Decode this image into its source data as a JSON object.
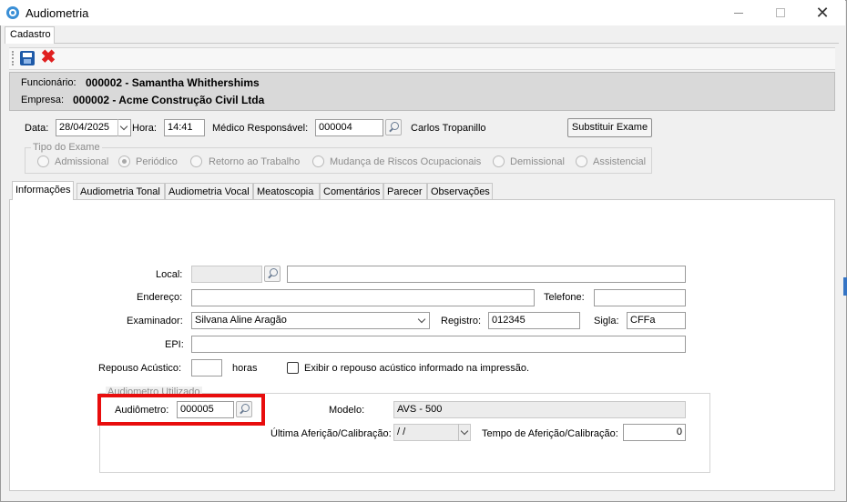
{
  "window": {
    "title": "Audiometria"
  },
  "page_tab": "Cadastro",
  "toolbar": {
    "save_icon": "save-icon",
    "delete_icon": "delete-icon"
  },
  "header": {
    "employee_label": "Funcionário:",
    "employee_value": "000002 - Samantha Whithershims",
    "company_label": "Empresa:",
    "company_value": "000002 - Acme Construção Civil Ltda"
  },
  "form": {
    "date_label": "Data:",
    "date_value": "28/04/2025",
    "time_label": "Hora:",
    "time_value": "14:41",
    "doctor_label": "Médico Responsável:",
    "doctor_code": "000004",
    "doctor_name": "Carlos Tropanillo",
    "replace_button": "Substituir Exame"
  },
  "exam_type": {
    "title": "Tipo do Exame",
    "options": [
      "Admissional",
      "Periódico",
      "Retorno ao Trabalho",
      "Mudança de Riscos Ocupacionais",
      "Demissional",
      "Assistencial"
    ],
    "selected": "Periódico"
  },
  "tabs": [
    "Informações",
    "Audiometria Tonal",
    "Audiometria Vocal",
    "Meatoscopia",
    "Comentários",
    "Parecer",
    "Observações"
  ],
  "active_tab": "Informações",
  "info": {
    "local_label": "Local:",
    "local_code": "",
    "local_value": "",
    "address_label": "Endereço:",
    "address_value": "",
    "phone_label": "Telefone:",
    "phone_value": "",
    "examiner_label": "Examinador:",
    "examiner_value": "Silvana Aline Aragão",
    "registry_label": "Registro:",
    "registry_value": "012345",
    "acronym_label": "Sigla:",
    "acronym_value": "CFFa",
    "epi_label": "EPI:",
    "epi_value": "",
    "rest_label": "Repouso Acústico:",
    "rest_value": "",
    "rest_unit": "horas",
    "show_rest_label": "Exibir o repouso acústico informado na impressão.",
    "show_rest_checked": false
  },
  "audiometer": {
    "group_title": "Audiometro Utilizado",
    "audiometer_label": "Audiômetro:",
    "audiometer_value": "000005",
    "model_label": "Modelo:",
    "model_value": "AVS - 500",
    "last_calibration_label": "Última Aferição/Calibração:",
    "last_calibration_value": " / /",
    "calibration_time_label": "Tempo de Aferição/Calibração:",
    "calibration_time_value": "0"
  },
  "colors": {
    "highlight": "#e80d0d",
    "header_bg": "#d9d9d9",
    "save_blue": "#1e5aa8",
    "delete_red": "#e01f1f"
  }
}
